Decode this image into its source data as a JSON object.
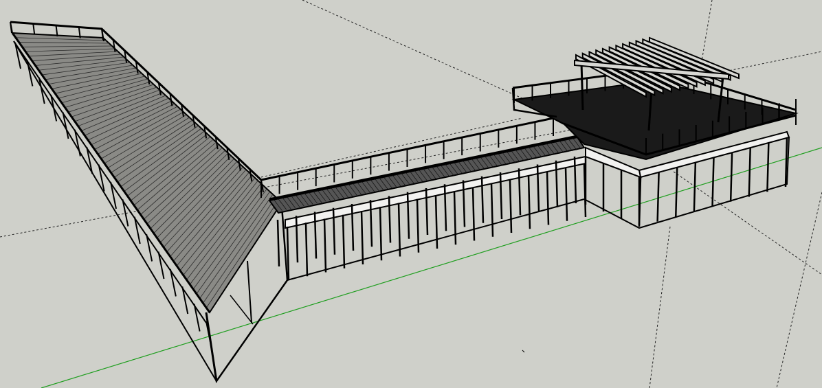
{
  "viewport": {
    "background_color": "#cfd0ca",
    "line_color": "#000000",
    "deck_fill_color": "#1a1a1a",
    "green_axis_color": "#1e9e1e",
    "dashed_axis_color": "#202020"
  }
}
